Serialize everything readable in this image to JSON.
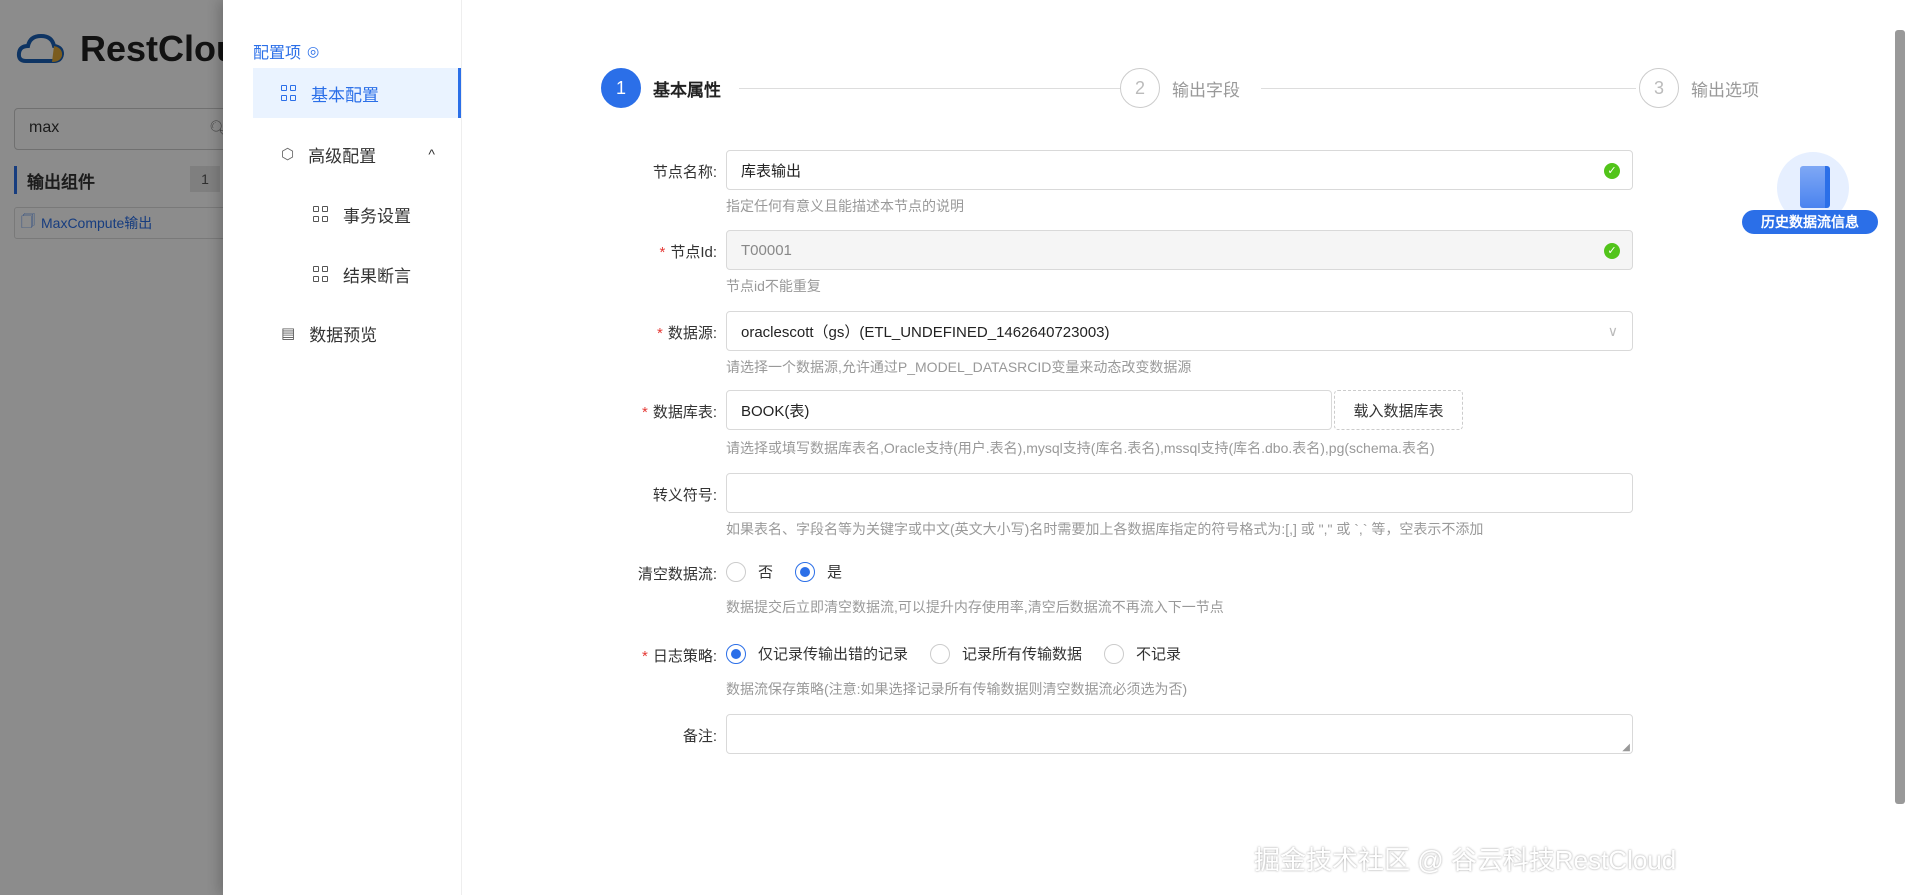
{
  "background_app": {
    "logo_text": "RestCloud",
    "search_value": "max",
    "group_label": "输出组件",
    "group_count": "1",
    "item_label": "MaxCompute输出"
  },
  "menu": {
    "title": "配置项",
    "items": [
      {
        "label": "基本配置",
        "active": true
      },
      {
        "label": "高级配置",
        "expanded": true
      },
      {
        "label": "事务设置"
      },
      {
        "label": "结果断言"
      },
      {
        "label": "数据预览"
      }
    ]
  },
  "steps": [
    {
      "num": "1",
      "label": "基本属性",
      "active": true
    },
    {
      "num": "2",
      "label": "输出字段"
    },
    {
      "num": "3",
      "label": "输出选项"
    }
  ],
  "form": {
    "node_name": {
      "label": "节点名称:",
      "value": "库表输出",
      "help": "指定任何有意义且能描述本节点的说明"
    },
    "node_id": {
      "label": "节点Id:",
      "value": "T00001",
      "help": "节点id不能重复"
    },
    "datasource": {
      "label": "数据源:",
      "value": "oraclescott（gs）(ETL_UNDEFINED_1462640723003)",
      "help": "请选择一个数据源,允许通过P_MODEL_DATASRCID变量来动态改变数据源"
    },
    "table": {
      "label": "数据库表:",
      "value": "BOOK(表)",
      "button": "载入数据库表",
      "help": "请选择或填写数据库表名,Oracle支持(用户.表名),mysql支持(库名.表名),mssql支持(库名.dbo.表名),pg(schema.表名)"
    },
    "escape": {
      "label": "转义符号:",
      "value": "",
      "help": "如果表名、字段名等为关键字或中文(英文大小写)名时需要加上各数据库指定的符号格式为:[,] 或 \",\" 或 `,` 等，空表示不添加"
    },
    "clear_stream": {
      "label": "清空数据流:",
      "options": [
        "否",
        "是"
      ],
      "selected": "是",
      "help": "数据提交后立即清空数据流,可以提升内存使用率,清空后数据流不再流入下一节点"
    },
    "log_policy": {
      "label": "日志策略:",
      "options": [
        "仅记录传输出错的记录",
        "记录所有传输数据",
        "不记录"
      ],
      "selected": "仅记录传输出错的记录",
      "help": "数据流保存策略(注意:如果选择记录所有传输数据则清空数据流必须选为否)"
    },
    "remark": {
      "label": "备注:",
      "value": ""
    }
  },
  "history_badge": "历史数据流信息",
  "watermark": "掘金技术社区 @ 谷云科技RestCloud",
  "colors": {
    "primary": "#2b6fe8",
    "success": "#52c41a",
    "required": "#e53935"
  }
}
